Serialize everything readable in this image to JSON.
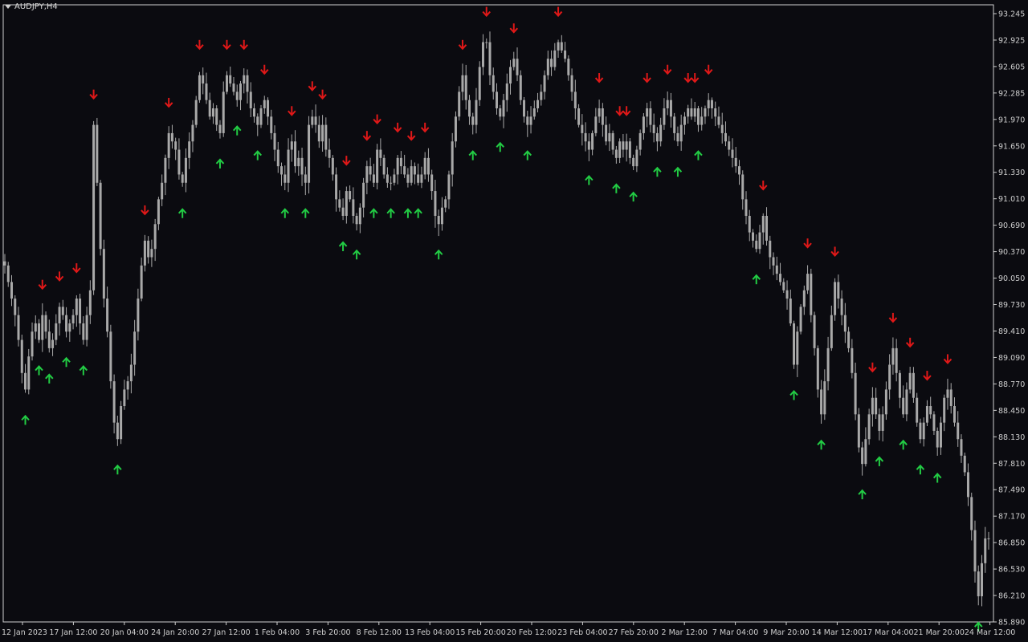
{
  "chart_data": {
    "type": "candlestick",
    "title": "AUDJPY,H4",
    "y_ticks": [
      "93.245",
      "92.925",
      "92.605",
      "92.285",
      "91.970",
      "91.650",
      "91.330",
      "91.010",
      "90.690",
      "90.370",
      "90.050",
      "89.730",
      "89.410",
      "89.090",
      "88.770",
      "88.450",
      "88.130",
      "87.810",
      "87.490",
      "87.170",
      "86.850",
      "86.530",
      "86.210",
      "85.890"
    ],
    "x_ticks": [
      "12 Jan 2023",
      "17 Jan 12:00",
      "20 Jan 04:00",
      "24 Jan 20:00",
      "27 Jan 12:00",
      "1 Feb 04:00",
      "3 Feb 20:00",
      "8 Feb 12:00",
      "13 Feb 04:00",
      "15 Feb 20:00",
      "20 Feb 12:00",
      "23 Feb 04:00",
      "27 Feb 20:00",
      "2 Mar 12:00",
      "7 Mar 04:00",
      "9 Mar 20:00",
      "14 Mar 12:00",
      "17 Mar 04:00",
      "21 Mar 20:00",
      "24 Mar 12:00"
    ],
    "ylim": [
      85.89,
      93.245
    ],
    "grid": false,
    "colors": {
      "background": "#0b0b10",
      "candle": "#a9a9a9",
      "up_arrow": "#22cc44",
      "down_arrow": "#e01818",
      "axis": "#cfcfcf"
    },
    "close": [
      90.2,
      90.0,
      89.8,
      89.6,
      89.3,
      88.9,
      88.7,
      89.1,
      89.4,
      89.5,
      89.3,
      89.6,
      89.4,
      89.2,
      89.3,
      89.5,
      89.7,
      89.6,
      89.4,
      89.5,
      89.6,
      89.8,
      89.5,
      89.3,
      89.6,
      89.9,
      91.9,
      91.2,
      90.4,
      89.8,
      89.4,
      88.8,
      88.3,
      88.1,
      88.5,
      88.7,
      88.8,
      89.0,
      89.4,
      89.8,
      90.2,
      90.5,
      90.3,
      90.4,
      90.7,
      91.0,
      91.2,
      91.5,
      91.8,
      91.7,
      91.6,
      91.3,
      91.2,
      91.5,
      91.7,
      91.9,
      92.2,
      92.5,
      92.4,
      92.2,
      92.0,
      92.1,
      91.9,
      91.8,
      92.3,
      92.5,
      92.4,
      92.3,
      92.2,
      92.4,
      92.5,
      92.3,
      92.1,
      92.0,
      91.9,
      92.1,
      92.2,
      92.0,
      91.8,
      91.6,
      91.4,
      91.3,
      91.2,
      91.6,
      91.7,
      91.4,
      91.5,
      91.3,
      91.2,
      91.9,
      92.0,
      91.9,
      91.7,
      91.9,
      91.6,
      91.5,
      91.3,
      91.0,
      90.9,
      90.8,
      91.1,
      91.0,
      90.8,
      90.7,
      90.9,
      91.2,
      91.4,
      91.3,
      91.2,
      91.6,
      91.5,
      91.3,
      91.2,
      91.2,
      91.3,
      91.5,
      91.4,
      91.3,
      91.2,
      91.4,
      91.3,
      91.2,
      91.3,
      91.5,
      91.3,
      91.1,
      90.8,
      90.7,
      90.9,
      91.0,
      91.3,
      91.7,
      92.0,
      92.3,
      92.5,
      92.2,
      92.0,
      91.9,
      92.2,
      92.6,
      92.9,
      92.9,
      92.5,
      92.3,
      92.1,
      92.0,
      92.2,
      92.4,
      92.6,
      92.7,
      92.5,
      92.2,
      92.0,
      91.9,
      92.0,
      92.1,
      92.2,
      92.3,
      92.5,
      92.7,
      92.6,
      92.8,
      92.9,
      92.8,
      92.7,
      92.5,
      92.3,
      92.1,
      91.9,
      91.8,
      91.7,
      91.6,
      91.8,
      92.0,
      92.1,
      91.9,
      91.7,
      91.8,
      91.6,
      91.5,
      91.7,
      91.6,
      91.7,
      91.5,
      91.4,
      91.6,
      91.8,
      92.0,
      92.1,
      91.9,
      91.8,
      91.7,
      91.9,
      92.1,
      92.2,
      92.0,
      91.8,
      91.7,
      91.9,
      92.0,
      92.1,
      92.0,
      92.1,
      91.9,
      92.0,
      92.1,
      92.2,
      92.1,
      92.0,
      91.9,
      91.8,
      91.7,
      91.6,
      91.5,
      91.4,
      91.3,
      91.0,
      90.8,
      90.6,
      90.5,
      90.4,
      90.6,
      90.8,
      90.5,
      90.3,
      90.2,
      90.1,
      90.0,
      89.9,
      89.8,
      89.5,
      89.0,
      89.4,
      89.7,
      89.9,
      90.1,
      89.6,
      89.2,
      88.7,
      88.4,
      88.8,
      89.2,
      89.6,
      90.0,
      89.8,
      89.6,
      89.4,
      89.2,
      88.9,
      88.4,
      88.0,
      87.8,
      88.1,
      88.4,
      88.6,
      88.4,
      88.2,
      88.4,
      88.7,
      89.0,
      89.2,
      88.9,
      88.6,
      88.4,
      88.7,
      88.9,
      88.6,
      88.3,
      88.1,
      88.3,
      88.5,
      88.4,
      88.2,
      88.0,
      88.3,
      88.6,
      88.7,
      88.5,
      88.3,
      88.1,
      87.9,
      87.7,
      87.4,
      87.0,
      86.5,
      86.2,
      86.6,
      86.9,
      86.9
    ]
  }
}
